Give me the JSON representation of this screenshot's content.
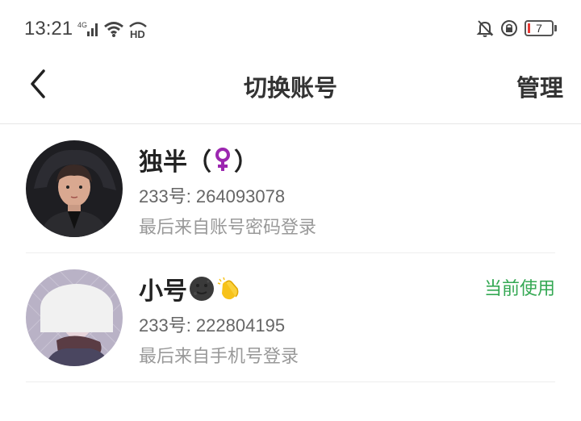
{
  "status_bar": {
    "time": "13:21",
    "network": "4G",
    "hd": "HD",
    "battery": "7"
  },
  "nav": {
    "title": "切换账号",
    "manage_label": "管理"
  },
  "accounts": [
    {
      "name": "独半（",
      "name_suffix": "）",
      "name_icon": "female-sign-icon",
      "id_text": "233号: 264093078",
      "login_text": "最后来自账号密码登录",
      "current_label": ""
    },
    {
      "name": "小号",
      "name_icon": "moon-face-icon",
      "name_icon2": "clapping-hands-icon",
      "id_text": "233号: 222804195",
      "login_text": "最后来自手机号登录",
      "current_label": "当前使用"
    }
  ],
  "colors": {
    "accent_green": "#34a853",
    "female_sign": "#9c27b0"
  }
}
